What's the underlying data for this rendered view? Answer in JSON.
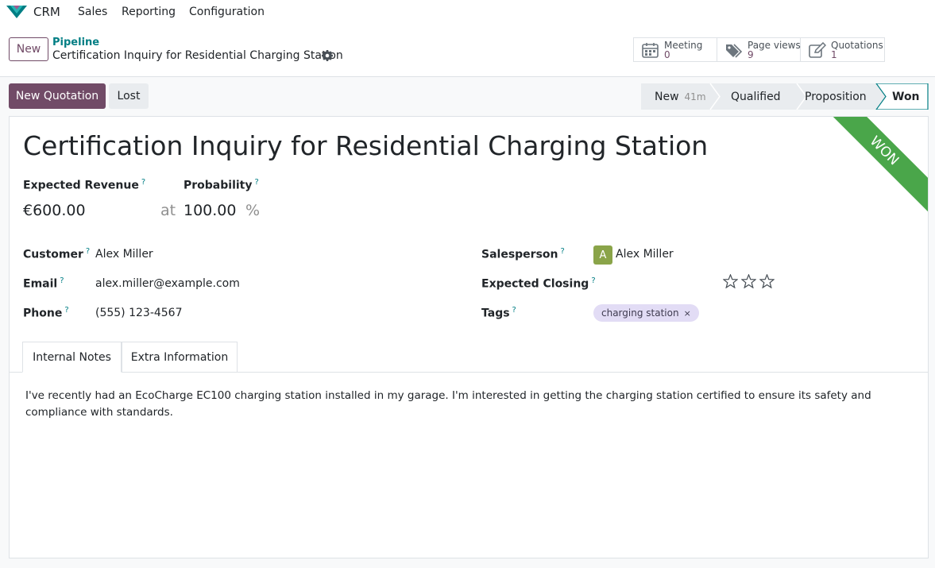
{
  "navbar": {
    "app_name": "CRM",
    "menu": [
      "Sales",
      "Reporting",
      "Configuration"
    ]
  },
  "control": {
    "new_label": "New",
    "breadcrumb_parent": "Pipeline",
    "breadcrumb_current": "Certification Inquiry for Residential Charging Station",
    "smart_buttons": [
      {
        "label": "Meeting",
        "value": "0",
        "icon": "calendar-icon"
      },
      {
        "label": "Page views",
        "value": "9",
        "icon": "tags-icon"
      },
      {
        "label": "Quotations",
        "value": "1",
        "icon": "edit-icon"
      }
    ]
  },
  "actions": {
    "new_quotation": "New Quotation",
    "lost": "Lost"
  },
  "stages": [
    {
      "label": "New",
      "duration": "41m"
    },
    {
      "label": "Qualified"
    },
    {
      "label": "Proposition"
    },
    {
      "label": "Won"
    }
  ],
  "record": {
    "ribbon": "WON",
    "title": "Certification Inquiry for Residential Charging Station",
    "expected_revenue_label": "Expected Revenue",
    "expected_revenue": "€600.00",
    "at": "at",
    "probability_label": "Probability",
    "probability": "100.00",
    "percent": "%",
    "customer_label": "Customer",
    "customer": "Alex Miller",
    "email_label": "Email",
    "email": "alex.miller@example.com",
    "phone_label": "Phone",
    "phone": "(555) 123-4567",
    "salesperson_label": "Salesperson",
    "salesperson_initial": "A",
    "salesperson": "Alex Miller",
    "expected_closing_label": "Expected Closing",
    "priority_stars": 0,
    "tags_label": "Tags",
    "tags": [
      "charging station"
    ],
    "tag_remove": "×",
    "help_mark": "?"
  },
  "tabs": [
    "Internal Notes",
    "Extra Information"
  ],
  "note": "I've recently had an EcoCharge EC100 charging station installed in my garage. I'm interested in getting the charging station certified to ensure its safety and compliance with standards.",
  "colors": {
    "brand": "#714b67",
    "link": "#017e84",
    "won_ribbon": "#4aa64a",
    "tag_bg": "#e2dcf5",
    "avatar_bg": "#8aa449"
  }
}
